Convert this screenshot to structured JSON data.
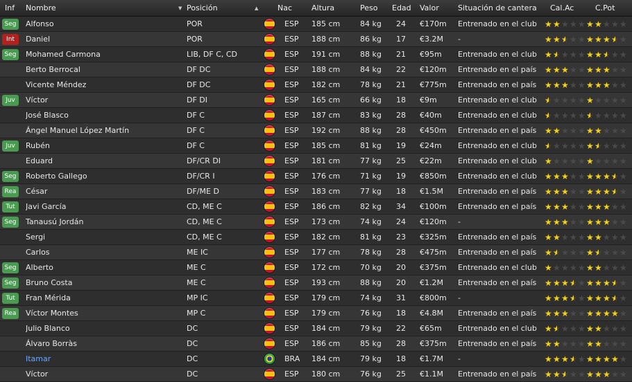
{
  "colors": {
    "header_bg": "#2f2f2f",
    "row_odd": "#2e2e2e",
    "row_even": "#363636",
    "star_gold": "#f5d21e",
    "star_empty": "#4a4a4a",
    "link_blue": "#6ea8ff",
    "badge_seg": "#3f8f4a",
    "badge_int": "#b52222"
  },
  "badge_colors": {
    "Seg": "#4a9a52",
    "Int": "#b3211f",
    "Juv": "#4a9a52",
    "Rea": "#4a9a52",
    "Tut": "#4a9a52"
  },
  "headers": {
    "inf": "Inf",
    "nombre": "Nombre",
    "posicion": "Posición",
    "nac": "Nac",
    "altura": "Altura",
    "peso": "Peso",
    "edad": "Edad",
    "valor": "Valor",
    "situacion": "Situación de cantera",
    "calac": "Cal.Ac",
    "cpot": "C.Pot"
  },
  "icons": {
    "sort_down": "sort-descending-icon",
    "sort_up": "sort-ascending-icon",
    "flag_esp": "flag-spain-icon",
    "flag_bra": "flag-brazil-icon",
    "star": "star-icon"
  },
  "rows": [
    {
      "inf": "Seg",
      "nombre": "Alfonso",
      "posicion": "POR",
      "nac": "ESP",
      "altura": "185 cm",
      "peso": "84 kg",
      "edad": "24",
      "valor": "€170m",
      "situacion": "Entrenado en el club",
      "calac": 2,
      "cpot": 2
    },
    {
      "inf": "Int",
      "nombre": "Daniel",
      "posicion": "POR",
      "nac": "ESP",
      "altura": "188 cm",
      "peso": "86 kg",
      "edad": "17",
      "valor": "€3.2M",
      "situacion": "-",
      "calac": 2.5,
      "cpot": 3.5
    },
    {
      "inf": "Seg",
      "nombre": "Mohamed Carmona",
      "posicion": "LIB, DF C, CD",
      "nac": "ESP",
      "altura": "191 cm",
      "peso": "88 kg",
      "edad": "21",
      "valor": "€95m",
      "situacion": "Entrenado en el club",
      "calac": 1.5,
      "cpot": 2.5
    },
    {
      "inf": "",
      "nombre": "Berto Berrocal",
      "posicion": "DF DC",
      "nac": "ESP",
      "altura": "188 cm",
      "peso": "84 kg",
      "edad": "22",
      "valor": "€120m",
      "situacion": "Entrenado en el país",
      "calac": 3,
      "cpot": 3
    },
    {
      "inf": "",
      "nombre": "Vicente Méndez",
      "posicion": "DF DC",
      "nac": "ESP",
      "altura": "182 cm",
      "peso": "78 kg",
      "edad": "21",
      "valor": "€775m",
      "situacion": "Entrenado en el país",
      "calac": 3,
      "cpot": 3
    },
    {
      "inf": "Juv",
      "nombre": "Víctor",
      "posicion": "DF DI",
      "nac": "ESP",
      "altura": "165 cm",
      "peso": "66 kg",
      "edad": "18",
      "valor": "€9m",
      "situacion": "Entrenado en el club",
      "calac": 0.5,
      "cpot": 1
    },
    {
      "inf": "",
      "nombre": "José Blasco",
      "posicion": "DF C",
      "nac": "ESP",
      "altura": "187 cm",
      "peso": "83 kg",
      "edad": "28",
      "valor": "€40m",
      "situacion": "Entrenado en el club",
      "calac": 0.5,
      "cpot": 0.5
    },
    {
      "inf": "",
      "nombre": "Ángel Manuel López Martín",
      "posicion": "DF C",
      "nac": "ESP",
      "altura": "192 cm",
      "peso": "88 kg",
      "edad": "28",
      "valor": "€450m",
      "situacion": "Entrenado en el país",
      "calac": 2,
      "cpot": 2
    },
    {
      "inf": "Juv",
      "nombre": "Rubén",
      "posicion": "DF C",
      "nac": "ESP",
      "altura": "185 cm",
      "peso": "81 kg",
      "edad": "19",
      "valor": "€24m",
      "situacion": "Entrenado en el club",
      "calac": 0.5,
      "cpot": 1.5
    },
    {
      "inf": "",
      "nombre": "Eduard",
      "posicion": "DF/CR DI",
      "nac": "ESP",
      "altura": "181 cm",
      "peso": "77 kg",
      "edad": "25",
      "valor": "€22m",
      "situacion": "Entrenado en el club",
      "calac": 1,
      "cpot": 1
    },
    {
      "inf": "Seg",
      "nombre": "Roberto Gallego",
      "posicion": "DF/CR I",
      "nac": "ESP",
      "altura": "176 cm",
      "peso": "71 kg",
      "edad": "19",
      "valor": "€850m",
      "situacion": "Entrenado en el club",
      "calac": 3,
      "cpot": 3.5
    },
    {
      "inf": "Rea",
      "nombre": "César",
      "posicion": "DF/ME D",
      "nac": "ESP",
      "altura": "183 cm",
      "peso": "77 kg",
      "edad": "18",
      "valor": "€1.5M",
      "situacion": "Entrenado en el país",
      "calac": 3,
      "cpot": 3.5
    },
    {
      "inf": "Tut",
      "nombre": "Javi García",
      "posicion": "CD, ME C",
      "nac": "ESP",
      "altura": "186 cm",
      "peso": "82 kg",
      "edad": "34",
      "valor": "€100m",
      "situacion": "Entrenado en el país",
      "calac": 3,
      "cpot": 3
    },
    {
      "inf": "Seg",
      "nombre": "Tanausú Jordán",
      "posicion": "CD, ME C",
      "nac": "ESP",
      "altura": "173 cm",
      "peso": "74 kg",
      "edad": "24",
      "valor": "€120m",
      "situacion": "-",
      "calac": 3,
      "cpot": 3
    },
    {
      "inf": "",
      "nombre": "Sergi",
      "posicion": "CD, ME C",
      "nac": "ESP",
      "altura": "182 cm",
      "peso": "81 kg",
      "edad": "23",
      "valor": "€325m",
      "situacion": "Entrenado en el país",
      "calac": 2,
      "cpot": 2
    },
    {
      "inf": "",
      "nombre": "Carlos",
      "posicion": "ME IC",
      "nac": "ESP",
      "altura": "177 cm",
      "peso": "78 kg",
      "edad": "28",
      "valor": "€475m",
      "situacion": "Entrenado en el país",
      "calac": 1.5,
      "cpot": 1.5
    },
    {
      "inf": "Seg",
      "nombre": "Alberto",
      "posicion": "ME C",
      "nac": "ESP",
      "altura": "172 cm",
      "peso": "70 kg",
      "edad": "20",
      "valor": "€375m",
      "situacion": "Entrenado en el club",
      "calac": 1,
      "cpot": 2
    },
    {
      "inf": "Seg",
      "nombre": "Bruno Costa",
      "posicion": "ME C",
      "nac": "ESP",
      "altura": "193 cm",
      "peso": "88 kg",
      "edad": "20",
      "valor": "€1.2M",
      "situacion": "Entrenado en el país",
      "calac": 3.5,
      "cpot": 3.5
    },
    {
      "inf": "Tut",
      "nombre": "Fran Mérida",
      "posicion": "MP IC",
      "nac": "ESP",
      "altura": "179 cm",
      "peso": "74 kg",
      "edad": "31",
      "valor": "€800m",
      "situacion": "-",
      "calac": 3.5,
      "cpot": 3.5
    },
    {
      "inf": "Rea",
      "nombre": "Víctor Montes",
      "posicion": "MP C",
      "nac": "ESP",
      "altura": "179 cm",
      "peso": "76 kg",
      "edad": "18",
      "valor": "€4.8M",
      "situacion": "Entrenado en el país",
      "calac": 3,
      "cpot": 4
    },
    {
      "inf": "",
      "nombre": "Julio Blanco",
      "posicion": "DC",
      "nac": "ESP",
      "altura": "184 cm",
      "peso": "79 kg",
      "edad": "22",
      "valor": "€65m",
      "situacion": "Entrenado en el club",
      "calac": 1.5,
      "cpot": 2
    },
    {
      "inf": "",
      "nombre": "Álvaro Borràs",
      "posicion": "DC",
      "nac": "ESP",
      "altura": "186 cm",
      "peso": "85 kg",
      "edad": "28",
      "valor": "€375m",
      "situacion": "Entrenado en el país",
      "calac": 2,
      "cpot": 2
    },
    {
      "inf": "",
      "nombre": "Itamar",
      "posicion": "DC",
      "nac": "BRA",
      "altura": "184 cm",
      "peso": "79 kg",
      "edad": "18",
      "valor": "€1.7M",
      "situacion": "-",
      "calac": 3.5,
      "cpot": 4,
      "highlight": true
    },
    {
      "inf": "",
      "nombre": "Víctor",
      "posicion": "DC",
      "nac": "ESP",
      "altura": "180 cm",
      "peso": "76 kg",
      "edad": "25",
      "valor": "€1.1M",
      "situacion": "Entrenado en el país",
      "calac": 2.5,
      "cpot": 3
    }
  ]
}
